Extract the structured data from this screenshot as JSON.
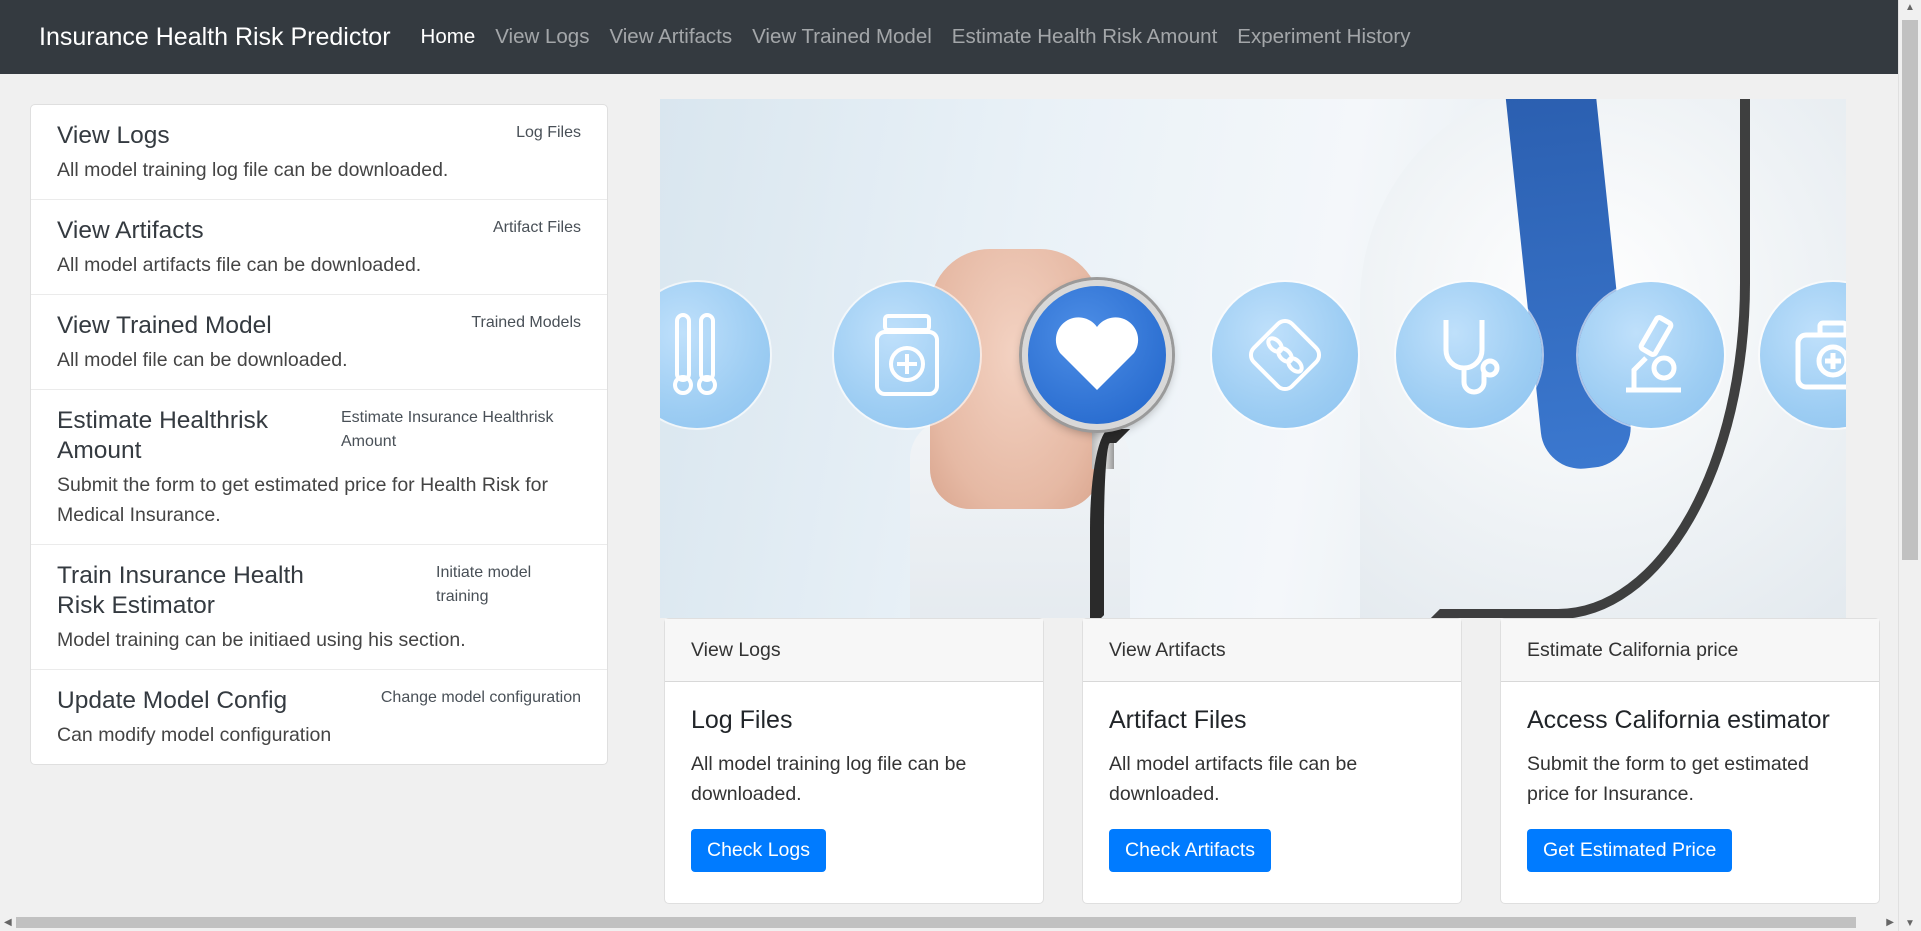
{
  "navbar": {
    "brand": "Insurance Health Risk Predictor",
    "links": [
      "Home",
      "View Logs",
      "View Artifacts",
      "View Trained Model",
      "Estimate Health Risk Amount",
      "Experiment History"
    ],
    "active": "Home"
  },
  "sidebar": {
    "items": [
      {
        "title": "View Logs",
        "badge": "Log Files",
        "desc": "All model training log file can be downloaded."
      },
      {
        "title": "View Artifacts",
        "badge": "Artifact Files",
        "desc": "All model artifacts file can be downloaded."
      },
      {
        "title": "View Trained Model",
        "badge": "Trained Models",
        "desc": "All model file can be downloaded."
      },
      {
        "title": "Estimate Healthrisk Amount",
        "badge": "Estimate Insurance Healthrisk Amount",
        "desc": "Submit the form to get estimated price for Health Risk for Medical Insurance."
      },
      {
        "title": "Train Insurance Health Risk Estimator",
        "badge": "Initiate model training",
        "desc": "Model training can be initiaed using his section."
      },
      {
        "title": "Update Model Config",
        "badge": "Change model configuration",
        "desc": "Can modify model configuration"
      }
    ]
  },
  "cards": [
    {
      "header": "View Logs",
      "title": "Log Files",
      "text": "All model training log file can be downloaded.",
      "button": "Check Logs"
    },
    {
      "header": "View Artifacts",
      "title": "Artifact Files",
      "text": "All model artifacts file can be downloaded.",
      "button": "Check Artifacts"
    },
    {
      "header": "Estimate California price",
      "title": "Access California estimator",
      "text": "Submit the form to get estimated price for Insurance.",
      "button": "Get Estimated Price"
    }
  ],
  "hero": {
    "icons": [
      "thermometer-icon",
      "medicine-bottle-icon",
      "heart-icon",
      "pills-icon",
      "stethoscope-icon",
      "microscope-icon",
      "first-aid-kit-icon"
    ]
  },
  "colors": {
    "navbar": "#343a40",
    "primary": "#007bff",
    "page_bg": "#f0f0f0"
  }
}
